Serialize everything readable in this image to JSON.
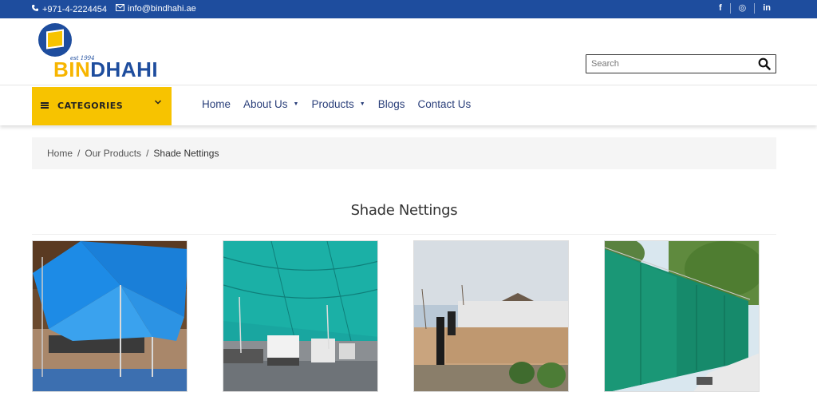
{
  "topbar": {
    "phone": "+971-4-2224454",
    "email": "info@bindhahi.ae",
    "social": [
      "f",
      "◎",
      "in"
    ]
  },
  "header": {
    "logo_est": "est 1994",
    "logo_bin": "BIN",
    "logo_dhahi": "DHAHI",
    "search_placeholder": "Search"
  },
  "nav": {
    "categories_label": "CATEGORIES",
    "items": [
      {
        "label": "Home",
        "dropdown": false
      },
      {
        "label": "About Us",
        "dropdown": true
      },
      {
        "label": "Products",
        "dropdown": true
      },
      {
        "label": "Blogs",
        "dropdown": false
      },
      {
        "label": "Contact Us",
        "dropdown": false
      }
    ]
  },
  "breadcrumb": {
    "home": "Home",
    "sep": "/",
    "our_products": "Our Products",
    "current": "Shade Nettings"
  },
  "page": {
    "title": "Shade Nettings"
  },
  "products": [
    {
      "image": "blue-shade-sail-courtyard"
    },
    {
      "image": "green-shade-net-parking"
    },
    {
      "image": "beige-netting-fence-construction"
    },
    {
      "image": "green-netting-fence-trees"
    }
  ],
  "colors": {
    "topbar": "#1e4d9e",
    "accent": "#f7c300",
    "nav_text": "#2a3f7a"
  }
}
